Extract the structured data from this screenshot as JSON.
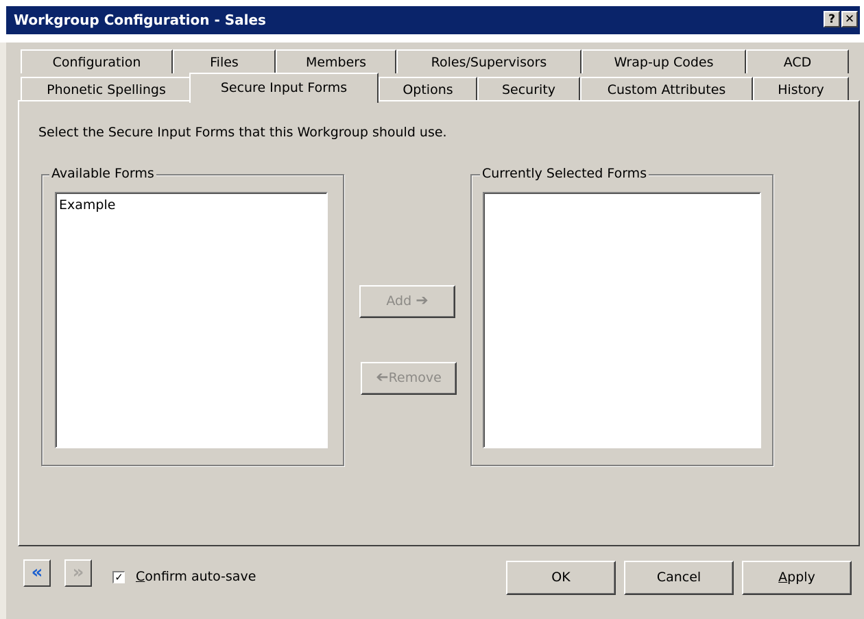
{
  "window": {
    "title": "Workgroup Configuration - Sales",
    "help_button": "?",
    "close_button": "✕"
  },
  "tabs": {
    "row1": [
      "Configuration",
      "Files",
      "Members",
      "Roles/Supervisors",
      "Wrap-up Codes",
      "ACD"
    ],
    "row2": [
      "Phonetic Spellings",
      "Secure Input Forms",
      "Options",
      "Security",
      "Custom Attributes",
      "History"
    ],
    "selected": "Secure Input Forms"
  },
  "page": {
    "instruction": "Select the Secure Input Forms that this Workgroup should use.",
    "available": {
      "label": "Available Forms",
      "items": [
        "Example"
      ]
    },
    "selected_forms": {
      "label": "Currently Selected Forms",
      "items": []
    },
    "add_label": "Add",
    "remove_label": "Remove"
  },
  "footer": {
    "back_icon": "«",
    "forward_icon": "»",
    "confirm_autosave": {
      "accel": "C",
      "rest": "onfirm auto-save",
      "checked": true,
      "checkmark": "✓"
    },
    "ok_label": "OK",
    "cancel_label": "Cancel",
    "apply": {
      "accel": "A",
      "rest": "pply"
    }
  },
  "colors": {
    "titlebar": "#0a246a",
    "face": "#d4d0c8",
    "nav_active": "#1a5fd0",
    "disabled_text": "#8c8a86"
  }
}
